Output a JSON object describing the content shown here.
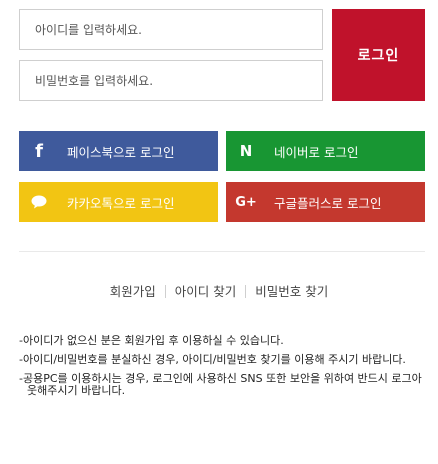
{
  "login": {
    "id_placeholder": "아이디를 입력하세요.",
    "password_placeholder": "비밀번호를 입력하세요.",
    "login_label": "로그인",
    "login_color": "#c0122b"
  },
  "social": {
    "facebook": {
      "icon": "facebook-icon",
      "glyph": "f",
      "label": "페이스북으로 로그인",
      "color": "#3f5a9c"
    },
    "naver": {
      "icon": "naver-icon",
      "glyph": "N",
      "label": "네이버로 로그인",
      "color": "#189633"
    },
    "kakao": {
      "icon": "kakao-talk-icon",
      "label": "카카오톡으로 로그인",
      "color": "#f2c513"
    },
    "google": {
      "icon": "google-plus-icon",
      "glyph": "G+",
      "label": "구글플러스로 로그인",
      "color": "#c4382e"
    }
  },
  "links": {
    "signup": "회원가입",
    "find_id": "아이디 찾기",
    "find_password": "비밀번호 찾기"
  },
  "notices": [
    "-아이디가 없으신 분은 회원가입 후 이용하실 수 있습니다.",
    "-아이디/비밀번호를 분실하신 경우, 아이디/비밀번호 찾기를 이용해 주시기 바랍니다.",
    "-공용PC를 이용하시는 경우, 로그인에 사용하신 SNS 또한 보안을 위하여 반드시 로그아웃해주시기 바랍니다."
  ]
}
